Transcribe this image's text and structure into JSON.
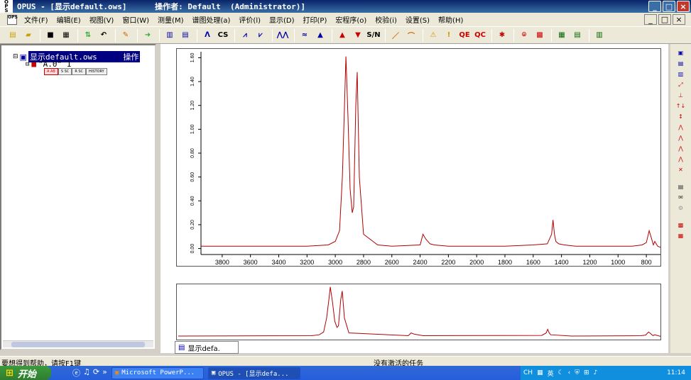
{
  "window": {
    "app_logo": "OPUS",
    "title": "OPUS - [显示default.ows]      操作者: Default  (Administrator)]",
    "min": "_",
    "max": "□",
    "close": "×"
  },
  "menu": {
    "items": [
      "文件(F)",
      "编辑(E)",
      "视图(V)",
      "窗口(W)",
      "测量(M)",
      "谱图处理(a)",
      "评价(l)",
      "显示(D)",
      "打印(P)",
      "宏程序(o)",
      "校验(i)",
      "设置(S)",
      "帮助(H)"
    ],
    "mdi_min": "_",
    "mdi_restore": "□",
    "mdi_close": "×"
  },
  "toolbar": {
    "icons": [
      "open-icon",
      "folder-icon",
      "save-icon",
      "save-all-icon",
      "sort-icon",
      "undo-icon",
      "name-icon",
      "arrow-icon",
      "table-icon",
      "grid-icon",
      "peak-icon",
      "cs-icon",
      "baseline-icon",
      "fit-icon",
      "wave-icon",
      "integrate-icon",
      "peak-pick-icon",
      "mark-icon",
      "sn-icon",
      "pen-icon",
      "edit-icon",
      "warning-icon",
      "exclaim-icon",
      "qe-icon",
      "qc-icon",
      "star-icon",
      "tag-icon",
      "color-icon",
      "layout-icon",
      "list-icon",
      "grid2-icon"
    ],
    "labels": {
      "cs": "CS",
      "qe": "QE",
      "qc": "QC",
      "sn": "S/N"
    }
  },
  "tree": {
    "root": "显示default.ows",
    "root_badge": "操作",
    "file": "\"A.0\" 1",
    "tabs": [
      "A AB",
      "S SC",
      "R SC",
      "HISTORY"
    ]
  },
  "chart_data": {
    "type": "line",
    "title": "",
    "xlabel": "",
    "ylabel": "",
    "x_ticks": [
      3800,
      3600,
      3400,
      3200,
      3000,
      2800,
      2600,
      2400,
      2200,
      2000,
      1800,
      1600,
      1400,
      1200,
      1000,
      800
    ],
    "y_ticks": [
      "0.00",
      "0.20",
      "0.40",
      "0.60",
      "0.80",
      "1.00",
      "1.20",
      "1.40",
      "1.60"
    ],
    "xlim": [
      3950,
      700
    ],
    "ylim": [
      -0.05,
      1.65
    ],
    "series": [
      {
        "color": "#b00000",
        "x": [
          3950,
          3800,
          3600,
          3400,
          3200,
          3050,
          3000,
          2970,
          2950,
          2935,
          2925,
          2910,
          2895,
          2880,
          2870,
          2855,
          2845,
          2830,
          2800,
          2700,
          2600,
          2400,
          2380,
          2360,
          2330,
          2300,
          2200,
          2000,
          1800,
          1600,
          1500,
          1470,
          1460,
          1450,
          1440,
          1420,
          1380,
          1300,
          1200,
          1000,
          900,
          830,
          800,
          780,
          760,
          750,
          740,
          720,
          700
        ],
        "y": [
          0.02,
          0.02,
          0.02,
          0.02,
          0.02,
          0.03,
          0.06,
          0.15,
          0.6,
          1.2,
          1.61,
          1.1,
          0.5,
          0.3,
          0.35,
          1.2,
          1.48,
          0.6,
          0.12,
          0.03,
          0.02,
          0.03,
          0.12,
          0.08,
          0.04,
          0.03,
          0.02,
          0.02,
          0.02,
          0.03,
          0.04,
          0.12,
          0.24,
          0.12,
          0.06,
          0.04,
          0.03,
          0.02,
          0.02,
          0.02,
          0.02,
          0.03,
          0.05,
          0.15,
          0.07,
          0.03,
          0.06,
          0.02,
          0.01
        ]
      }
    ]
  },
  "overview": {
    "series": [
      {
        "x": [
          3950,
          3050,
          3000,
          2970,
          2950,
          2935,
          2925,
          2910,
          2895,
          2880,
          2870,
          2855,
          2845,
          2830,
          2800,
          2400,
          2380,
          2360,
          2300,
          1500,
          1470,
          1460,
          1450,
          1440,
          1300,
          830,
          800,
          780,
          760,
          750,
          740,
          700
        ],
        "y": [
          0.02,
          0.03,
          0.06,
          0.15,
          0.6,
          1.2,
          1.61,
          1.1,
          0.5,
          0.3,
          0.35,
          1.2,
          1.48,
          0.6,
          0.12,
          0.03,
          0.12,
          0.08,
          0.03,
          0.04,
          0.12,
          0.24,
          0.12,
          0.06,
          0.02,
          0.03,
          0.05,
          0.15,
          0.07,
          0.03,
          0.06,
          0.01
        ]
      }
    ]
  },
  "doc_tab": "显示defa.",
  "right_toolbar": [
    "view-icon",
    "zoom-icon",
    "scale-icon",
    "expand-icon",
    "stack-icon",
    "shift-icon",
    "move-icon",
    "compress-icon",
    "peak-mark-icon",
    "peak-mark2-icon",
    "fit2-icon",
    "cross-icon",
    "print-icon",
    "mail-icon",
    "tool-icon",
    "hist-icon",
    "log-icon"
  ],
  "status": {
    "left": "要想得到帮助，请按F1键",
    "mid": "没有激活的任务"
  },
  "taskbar": {
    "start": "开始",
    "tasks": [
      "Microsoft PowerP...",
      "OPUS - [显示defa..."
    ],
    "tray_lang": "CH",
    "tray_ime": "英",
    "clock": "11:14"
  }
}
